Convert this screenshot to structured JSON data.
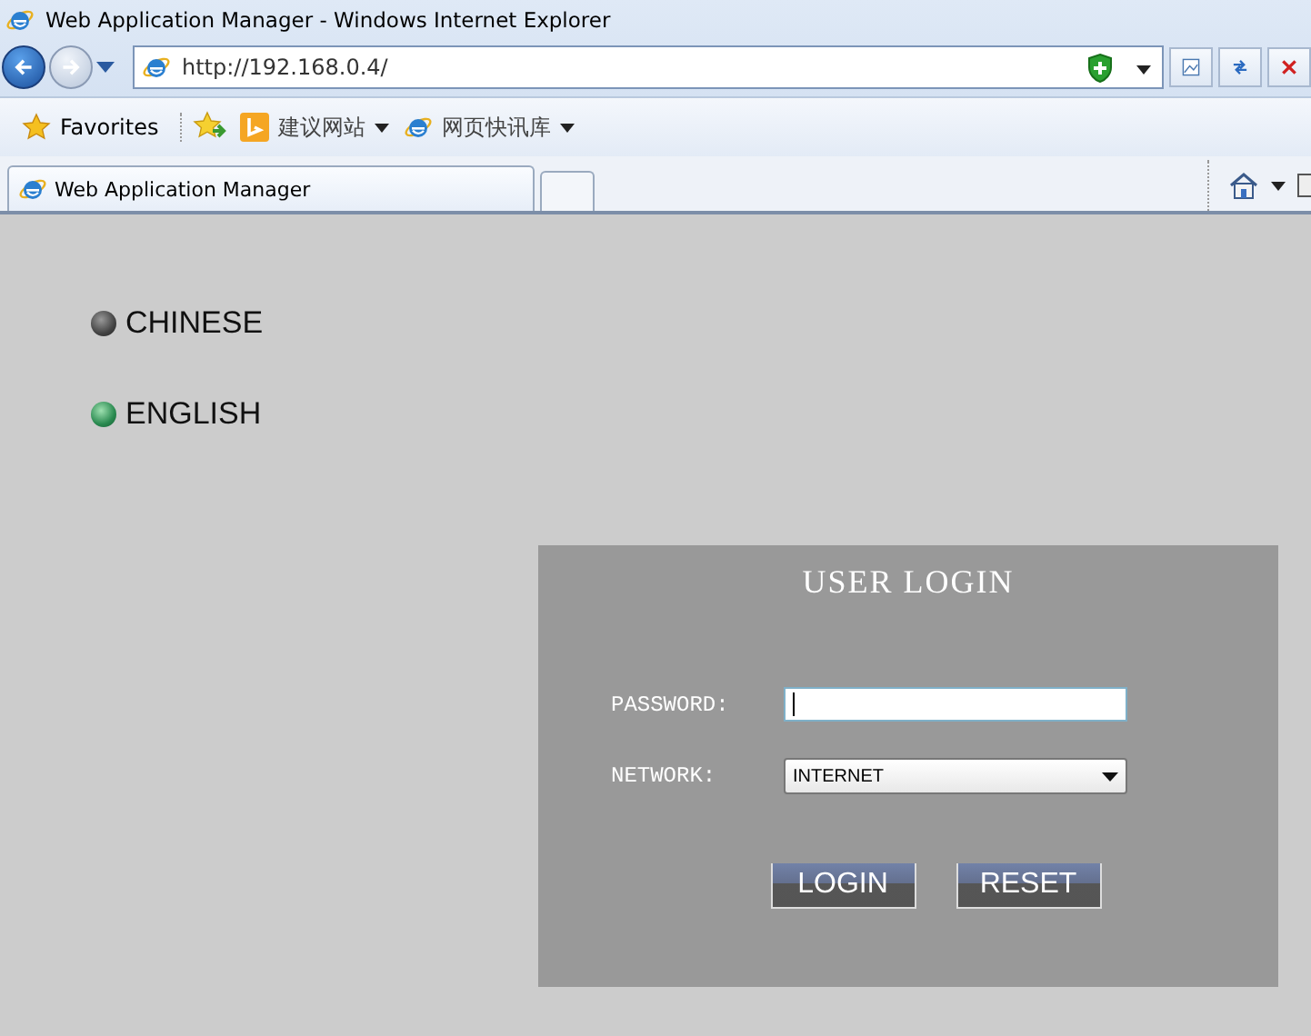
{
  "window": {
    "title": "Web Application Manager - Windows Internet Explorer"
  },
  "address_bar": {
    "url": "http://192.168.0.4/"
  },
  "favorites_bar": {
    "items": [
      {
        "label": "Favorites",
        "kind": "favorites",
        "has_menu": false
      },
      {
        "label": "建议网站",
        "kind": "suggested",
        "has_menu": true
      },
      {
        "label": "网页快讯库",
        "kind": "webslice",
        "has_menu": true
      }
    ]
  },
  "tabs": [
    {
      "label": "Web Application Manager",
      "selected": true
    }
  ],
  "languages": [
    {
      "label": "CHINESE",
      "selected": false
    },
    {
      "label": "ENGLISH",
      "selected": true
    }
  ],
  "login": {
    "title": "USER LOGIN",
    "fields": [
      {
        "label": "PASSWORD:",
        "kind": "password",
        "focused": true
      },
      {
        "label": "NETWORK:",
        "kind": "select",
        "value": "INTERNET"
      }
    ],
    "buttons": [
      "LOGIN",
      "RESET"
    ]
  }
}
